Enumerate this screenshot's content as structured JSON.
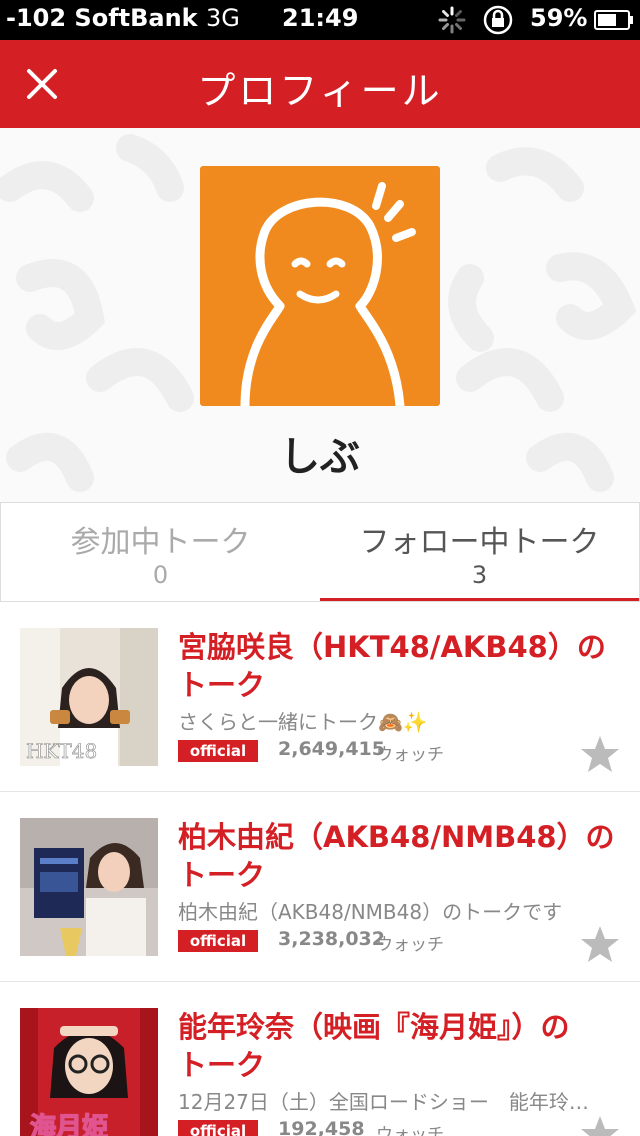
{
  "status_bar": {
    "carrier": "-102 SoftBank",
    "network": "3G",
    "time": "21:49",
    "battery": "59%"
  },
  "nav": {
    "title": "プロフィール",
    "close_icon": "close-icon"
  },
  "profile": {
    "name": "しぶ",
    "avatar_color": "#f08a1e"
  },
  "tabs": [
    {
      "label": "参加中トーク",
      "count": "0",
      "active": false
    },
    {
      "label": "フォロー中トーク",
      "count": "3",
      "active": true
    }
  ],
  "talks": [
    {
      "title_line1": "宮脇咲良（HKT48/AKB48）の",
      "title_line2": "トーク",
      "description": "さくらと一緒にトーク🙈✨",
      "badge": "official",
      "watch_count": "2,649,415",
      "watch_label": "ウォッチ",
      "thumb_text": "HKT48"
    },
    {
      "title_line1": "柏木由紀（AKB48/NMB48）の",
      "title_line2": "トーク",
      "description": "柏木由紀（AKB48/NMB48）のトークです",
      "badge": "official",
      "watch_count": "3,238,032",
      "watch_label": "ウォッチ",
      "thumb_text": ""
    },
    {
      "title_line1": "能年玲奈（映画『海月姫』）の",
      "title_line2": "トーク",
      "description": "12月27日（土）全国ロードショー　能年玲奈…",
      "badge": "official",
      "watch_count": "192,458",
      "watch_label": "ウォッチ",
      "thumb_text": "海月姫"
    }
  ],
  "colors": {
    "accent": "#d41f25",
    "status_bar": "#000000",
    "muted_text": "#888888",
    "star": "#bbbbbb"
  }
}
